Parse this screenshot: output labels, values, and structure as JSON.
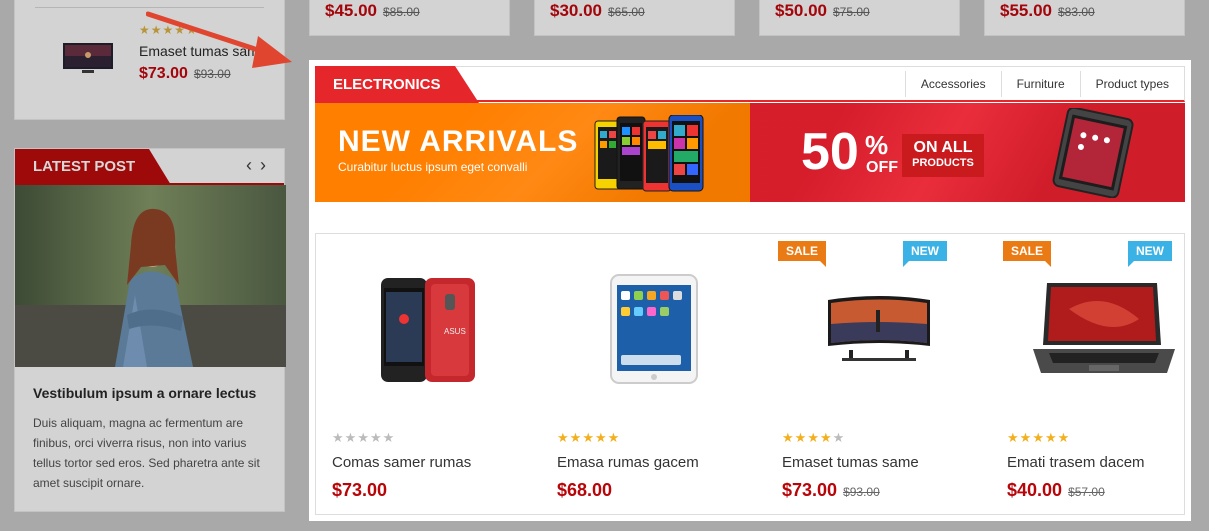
{
  "background": {
    "top_prices": [
      {
        "price": "$45.00",
        "old_price": "$85.00"
      },
      {
        "price": "$30.00",
        "old_price": "$65.00"
      },
      {
        "price": "$50.00",
        "old_price": "$75.00"
      },
      {
        "price": "$55.00",
        "old_price": "$83.00"
      }
    ],
    "side_product": {
      "name": "Emaset tumas same",
      "price": "$73.00",
      "old_price": "$93.00",
      "rating": 5
    },
    "latest_post": {
      "heading": "LATEST POST",
      "prev_icon": "chevron-left-icon",
      "next_icon": "chevron-right-icon",
      "title": "Vestibulum ipsum a ornare lectus",
      "excerpt": "Duis aliquam, magna ac fermentum are finibus, orci viverra risus, non into varius tellus tortor sed eros. Sed pharetra ante sit amet suscipit ornare."
    }
  },
  "section": {
    "title": "ELECTRONICS",
    "categories": [
      "Accessories",
      "Furniture",
      "Product types"
    ]
  },
  "banners": {
    "left": {
      "title": "NEW ARRIVALS",
      "subtitle": "Curabitur luctus ipsum eget convalli"
    },
    "right": {
      "percent": "50",
      "percent_sign": "%",
      "off": "OFF",
      "line1": "ON ALL",
      "line2": "PRODUCTS"
    }
  },
  "products": [
    {
      "name": "Comas samer rumas",
      "price": "$73.00",
      "old_price": "",
      "rating": 0,
      "badges": []
    },
    {
      "name": "Emasa rumas gacem",
      "price": "$68.00",
      "old_price": "",
      "rating": 5,
      "badges": []
    },
    {
      "name": "Emaset tumas same",
      "price": "$73.00",
      "old_price": "$93.00",
      "rating": 4,
      "badges": [
        "SALE",
        "NEW"
      ]
    },
    {
      "name": "Emati trasem dacem",
      "price": "$40.00",
      "old_price": "$57.00",
      "rating": 5,
      "badges": [
        "SALE",
        "NEW"
      ]
    }
  ],
  "colors": {
    "accent": "#e5262b",
    "price": "#c9060c",
    "sale": "#ea7a13",
    "new": "#3ab2e5",
    "star": "#f2b01e"
  }
}
